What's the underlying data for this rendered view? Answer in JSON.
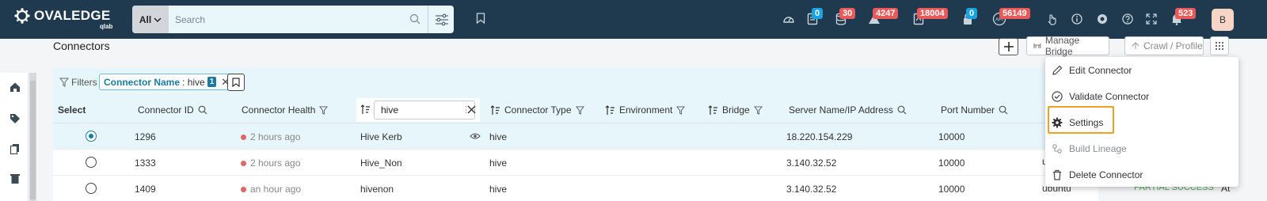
{
  "app": {
    "logo_text": "OVALEDGE",
    "logo_sub": "qlab"
  },
  "search": {
    "scope": "All",
    "placeholder": "Search",
    "value": ""
  },
  "badges": {
    "notifications_a": "0",
    "datasets": "30",
    "alerts": "4247",
    "queries": "18004",
    "locks": "0",
    "api": "56149",
    "messages": "523"
  },
  "user": {
    "initial": "B"
  },
  "page": {
    "title": "Connectors",
    "manage_bridge": "Manage Bridge",
    "crawl_profile": "Crawl / Profile"
  },
  "filterbar": {
    "label": "Filters",
    "chip_key": "Connector Name",
    "chip_value": ": hive",
    "chip_count": "1"
  },
  "table": {
    "headers": {
      "select": "Select",
      "connector_id": "Connector ID",
      "connector_health": "Connector Health",
      "connector_name_filter": "hive",
      "connector_type": "Connector Type",
      "environment": "Environment",
      "bridge": "Bridge",
      "server": "Server Name/IP Address",
      "port": "Port Number"
    },
    "rows": [
      {
        "id": "1296",
        "health": "2 hours ago",
        "name": "Hive Kerb",
        "type": "hive",
        "server": "18.220.154.229",
        "port": "10000",
        "selected": true
      },
      {
        "id": "1333",
        "health": "2 hours ago",
        "name": "Hive_Non",
        "type": "hive",
        "server": "3.140.32.52",
        "port": "10000",
        "selected": false
      },
      {
        "id": "1409",
        "health": "an hour ago",
        "name": "hivenon",
        "type": "hive",
        "server": "3.140.32.52",
        "port": "10000",
        "selected": false
      }
    ],
    "partial": {
      "row2_user": "u",
      "row3_user": "ubuntu",
      "row3_status": "PARTIAL SUCCESS",
      "row3_tail": "At"
    }
  },
  "menu": {
    "items": [
      {
        "label": "Edit Connector",
        "icon": "pencil-icon",
        "disabled": false
      },
      {
        "label": "Validate Connector",
        "icon": "check-circle-icon",
        "disabled": false
      },
      {
        "label": "Settings",
        "icon": "gear-icon",
        "disabled": false
      },
      {
        "label": "Build Lineage",
        "icon": "lineage-icon",
        "disabled": true
      },
      {
        "label": "Delete Connector",
        "icon": "trash-icon",
        "disabled": false
      }
    ]
  },
  "colors": {
    "topbar": "#1f3a4f",
    "accent": "#1a7aa0",
    "badge_red": "#e85a5a",
    "badge_blue": "#1aa3e0",
    "highlight_frame": "#f0a020"
  }
}
